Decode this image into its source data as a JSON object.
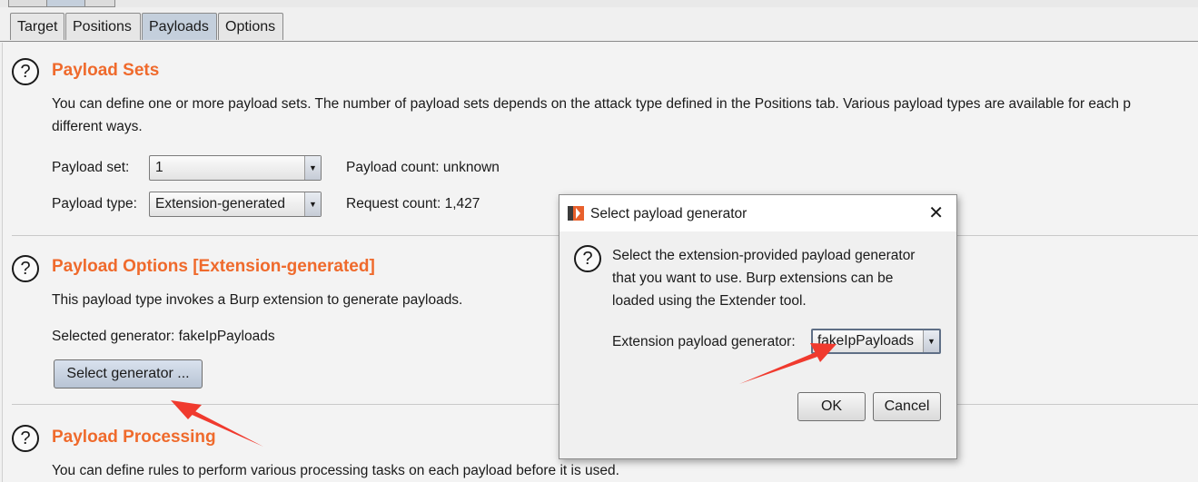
{
  "tabs": [
    {
      "label": "Target",
      "active": false
    },
    {
      "label": "Positions",
      "active": false
    },
    {
      "label": "Payloads",
      "active": true
    },
    {
      "label": "Options",
      "active": false
    }
  ],
  "payload_sets": {
    "title": "Payload Sets",
    "description_line1": "You can define one or more payload sets. The number of payload sets depends on the attack type defined in the Positions tab. Various payload types are available for each p",
    "description_line2": "different ways.",
    "set_label": "Payload set:",
    "set_value": "1",
    "type_label": "Payload type:",
    "type_value": "Extension-generated",
    "payload_count": "Payload count: unknown",
    "request_count": "Request count: 1,427"
  },
  "payload_options": {
    "title": "Payload Options [Extension-generated]",
    "description": "This payload type invokes a Burp extension to generate payloads.",
    "selected_generator": "Selected generator: fakeIpPayloads",
    "select_button": "Select generator ..."
  },
  "payload_processing": {
    "title": "Payload Processing",
    "description": "You can define rules to perform various processing tasks on each payload before it is used."
  },
  "dialog": {
    "title": "Select payload generator",
    "close_glyph": "✕",
    "message_line1": "Select the extension-provided payload generator",
    "message_line2": "that you want to use. Burp extensions can be",
    "message_line3": "loaded using the Extender tool.",
    "generator_label": "Extension payload generator:",
    "generator_value": "fakeIpPayloads",
    "ok_label": "OK",
    "cancel_label": "Cancel"
  },
  "icons": {
    "help": "?",
    "dropdown": "▼",
    "app_icon": "burp-logo-icon"
  },
  "colors": {
    "section_title": "#ef6a2c",
    "annotation_arrow": "#f03a2e",
    "active_tab": "#c4cfdc"
  }
}
